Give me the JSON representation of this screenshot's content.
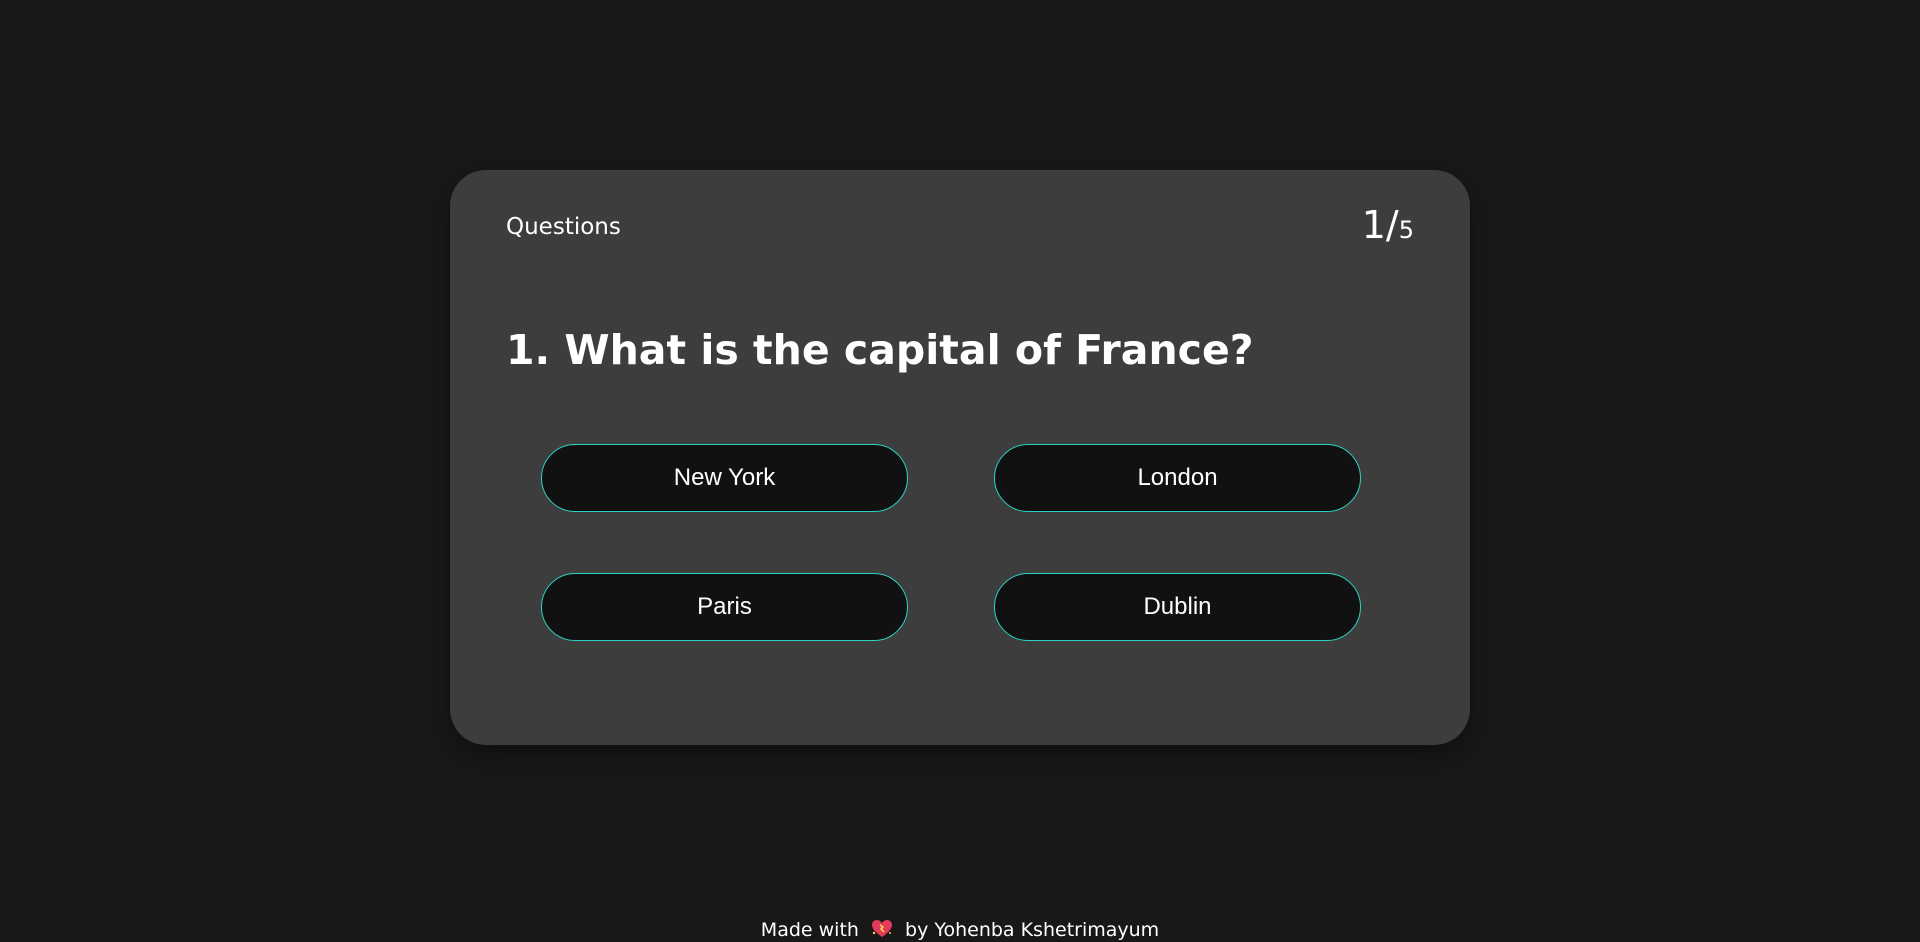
{
  "quiz": {
    "header_label": "Questions",
    "counter": {
      "current": "1",
      "separator": "/",
      "total": "5"
    },
    "question_text": "1. What is the capital of France?",
    "answers": [
      {
        "label": "New York"
      },
      {
        "label": "London"
      },
      {
        "label": "Paris"
      },
      {
        "label": "Dublin"
      }
    ]
  },
  "footer": {
    "prefix": "Made with",
    "icon": "sparkling-heart-icon",
    "suffix": "by Yohenba Kshetrimayum"
  },
  "colors": {
    "page_background": "#181818",
    "card_background": "#3d3d3d",
    "answer_background": "#111111",
    "answer_border": "#2ad4c3",
    "text": "#ffffff",
    "heart": "#e23a5b"
  }
}
